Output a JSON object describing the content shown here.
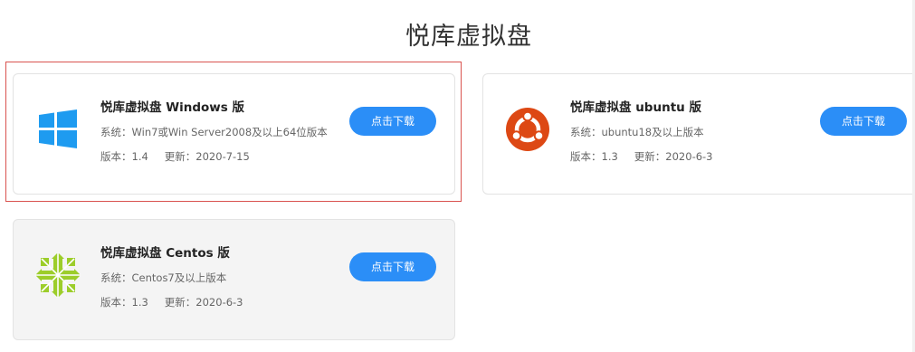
{
  "page": {
    "title": "悦库虚拟盘"
  },
  "cards": [
    {
      "id": "windows",
      "icon": "windows-logo-icon",
      "title": "悦库虚拟盘 Windows 版",
      "system": "系统：Win7或Win Server2008及以上64位版本",
      "version": "版本：1.4",
      "updated": "更新：2020-7-15",
      "button": "点击下载"
    },
    {
      "id": "ubuntu",
      "icon": "ubuntu-logo-icon",
      "title": "悦库虚拟盘 ubuntu 版",
      "system": "系统：ubuntu18及以上版本",
      "version": "版本：1.3",
      "updated": "更新：2020-6-3",
      "button": "点击下载"
    },
    {
      "id": "centos",
      "icon": "centos-logo-icon",
      "title": "悦库虚拟盘 Centos 版",
      "system": "系统：Centos7及以上版本",
      "version": "版本：1.3",
      "updated": "更新：2020-6-3",
      "button": "点击下载"
    }
  ],
  "colors": {
    "button": "#2b8ef7",
    "windows": "#1e9bf0",
    "ubuntu": "#dd4814",
    "centos": "#9ccd2a",
    "highlight": "#d9534f"
  }
}
